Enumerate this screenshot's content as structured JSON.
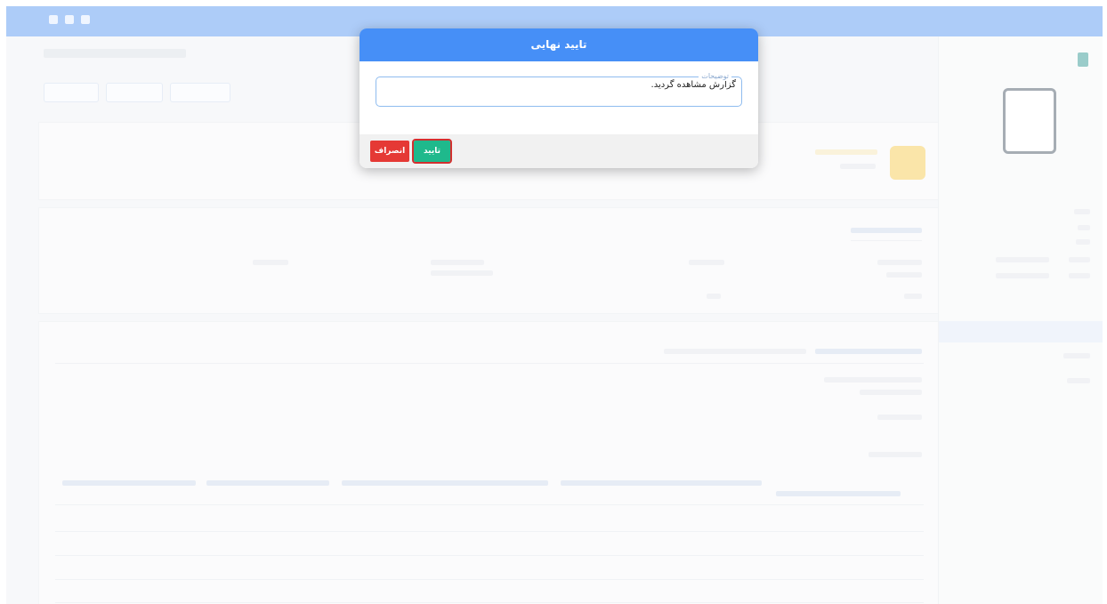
{
  "modal": {
    "title": "تایید نهایی",
    "field_label": "توضیحات",
    "field_value": "گزارش مشاهده گردید.",
    "confirm_label": "تایید",
    "cancel_label": "انصراف"
  },
  "colors": {
    "header_blue": "#468ff7",
    "confirm_green": "#1fb98c",
    "cancel_red": "#e53935",
    "focus_outline": "#d32f2f"
  }
}
